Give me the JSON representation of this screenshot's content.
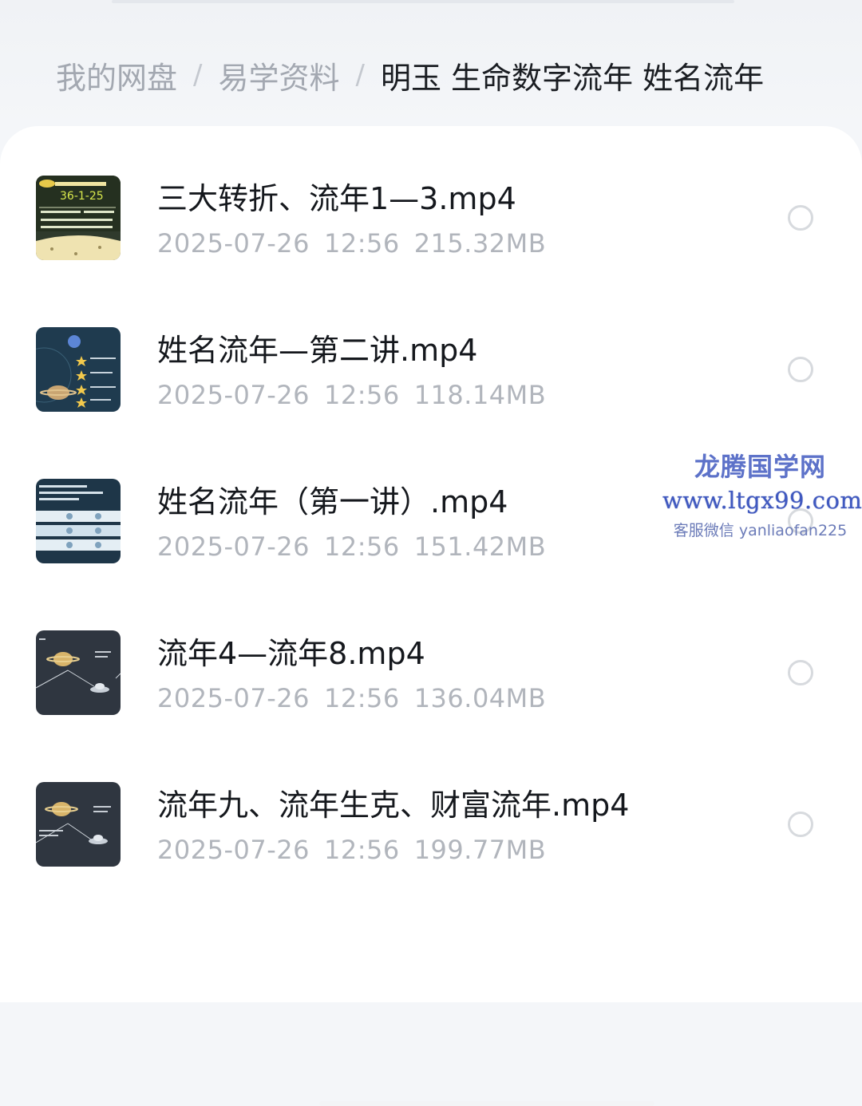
{
  "breadcrumb": {
    "items": [
      "我的网盘",
      "易学资料"
    ],
    "current": "明玉 生命数字流年 姓名流年",
    "separator": "/"
  },
  "files": [
    {
      "name": "三大转折、流年1—3.mp4",
      "date": "2025-07-26",
      "time": "12:56",
      "size": "215.32MB",
      "thumb": "yellow-notes"
    },
    {
      "name": "姓名流年—第二讲.mp4",
      "date": "2025-07-26",
      "time": "12:56",
      "size": "118.14MB",
      "thumb": "navy-stars"
    },
    {
      "name": "姓名流年（第一讲）.mp4",
      "date": "2025-07-26",
      "time": "12:56",
      "size": "151.42MB",
      "thumb": "table-slide"
    },
    {
      "name": "流年4—流年8.mp4",
      "date": "2025-07-26",
      "time": "12:56",
      "size": "136.04MB",
      "thumb": "dark-planet"
    },
    {
      "name": "流年九、流年生克、财富流年.mp4",
      "date": "2025-07-26",
      "time": "12:56",
      "size": "199.77MB",
      "thumb": "dark-planet-2"
    }
  ],
  "watermark": {
    "title": "龙腾国学网",
    "url": "www.ltgx99.com",
    "contact": "客服微信 yanliaofan225"
  },
  "colors": {
    "current_crumb": "#1a1d22",
    "muted_text": "#b1b5bc",
    "watermark": "#4059c0"
  }
}
